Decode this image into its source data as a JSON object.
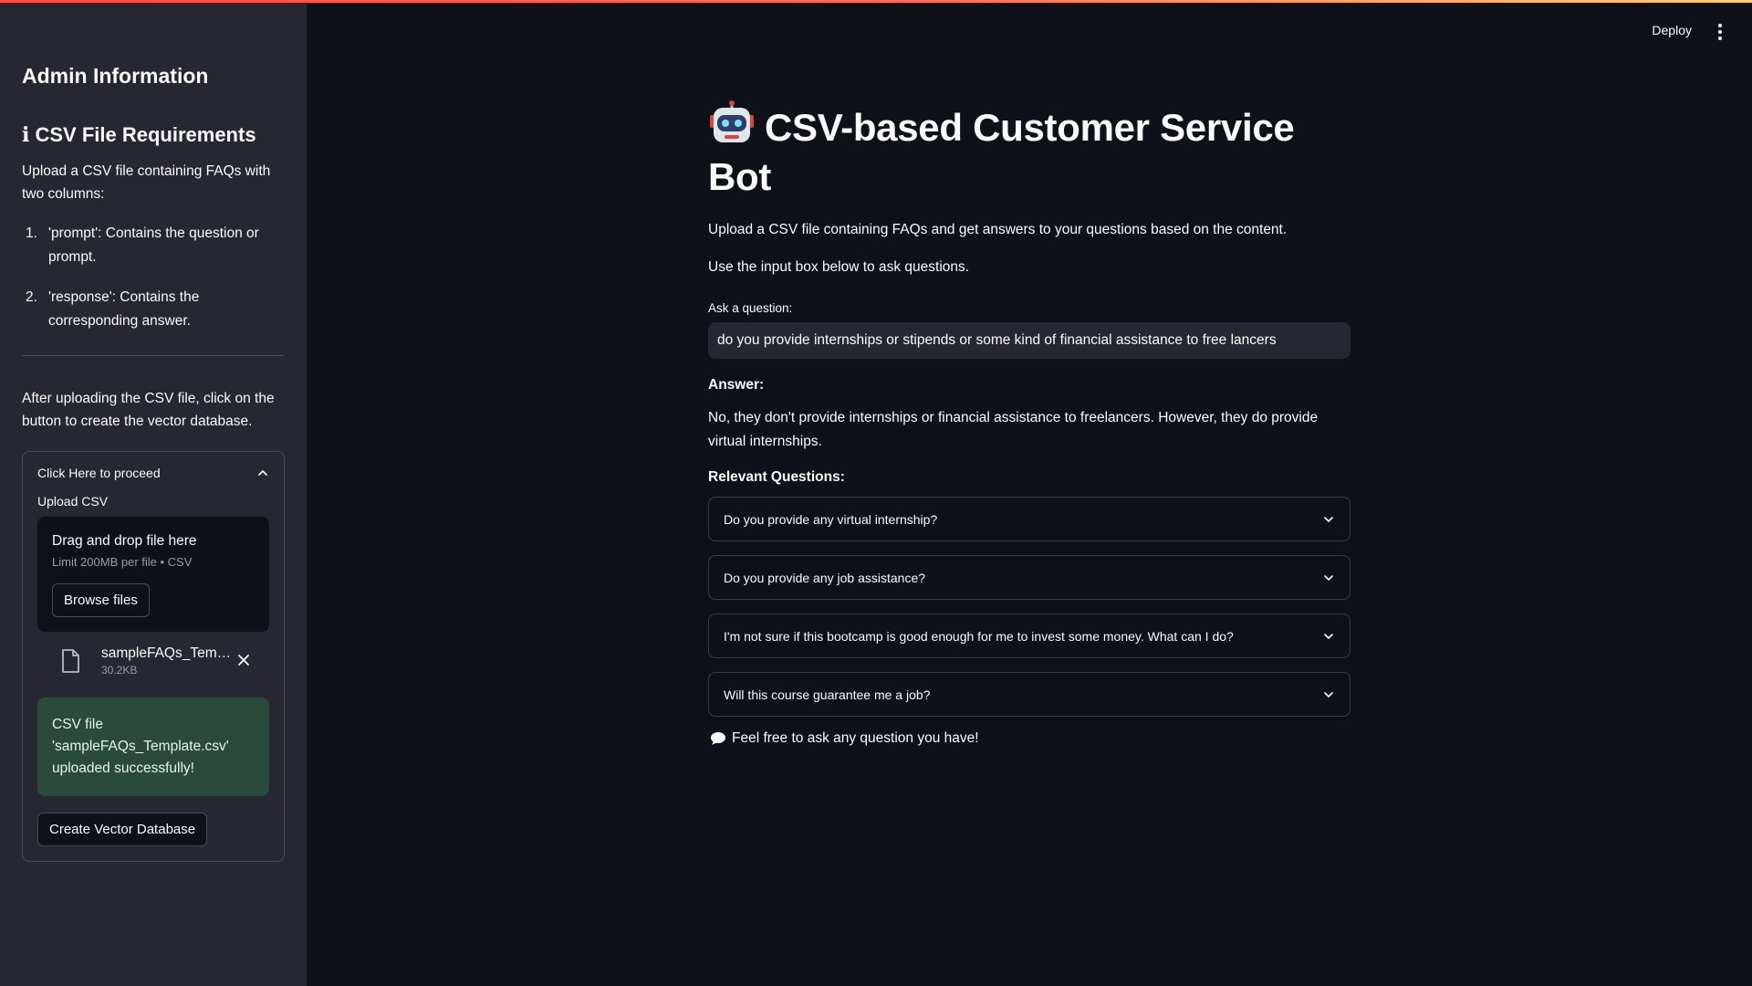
{
  "sidebar": {
    "title": "Admin Information",
    "requirements_heading": "CSV File Requirements",
    "requirements_intro": "Upload a CSV file containing FAQs with two columns:",
    "requirements_items": [
      {
        "num": "1.",
        "text": "'prompt': Contains the question or prompt."
      },
      {
        "num": "2.",
        "text": "'response': Contains the corresponding answer."
      }
    ],
    "after_upload_text": "After uploading the CSV file, click on the button to create the vector database.",
    "expander": {
      "label": "Click Here to proceed",
      "upload_label": "Upload CSV",
      "dropzone_title": "Drag and drop file here",
      "dropzone_limit": "Limit 200MB per file • CSV",
      "browse_button": "Browse files",
      "file_name": "sampleFAQs_Template.csv",
      "file_size": "30.2KB",
      "success_message": "CSV file 'sampleFAQs_Template.csv' uploaded successfully!",
      "create_button": "Create Vector Database"
    }
  },
  "header": {
    "deploy_label": "Deploy"
  },
  "main": {
    "title": "CSV-based Customer Service Bot",
    "intro": "Upload a CSV file containing FAQs and get answers to your questions based on the content.",
    "instruction": "Use the input box below to ask questions.",
    "input_label": "Ask a question:",
    "input_value": "do you provide internships or stipends or some kind of financial assistance to free lancers",
    "answer_heading": "Answer:",
    "answer_text": "No, they don't provide internships or financial assistance to freelancers. However, they do provide virtual internships.",
    "relevant_heading": "Relevant Questions:",
    "relevant_questions": [
      "Do you provide any virtual internship?",
      "Do you provide any job assistance?",
      "I'm not sure if this bootcamp is good enough for me to invest some money. What can I do?",
      "Will this course guarantee me a job?"
    ],
    "footer_text": "Feel free to ask any question you have!"
  },
  "colors": {
    "background": "#0e1117",
    "sidebar": "#262730",
    "success": "#2a4a3c",
    "accent": "#ff4b4b"
  }
}
